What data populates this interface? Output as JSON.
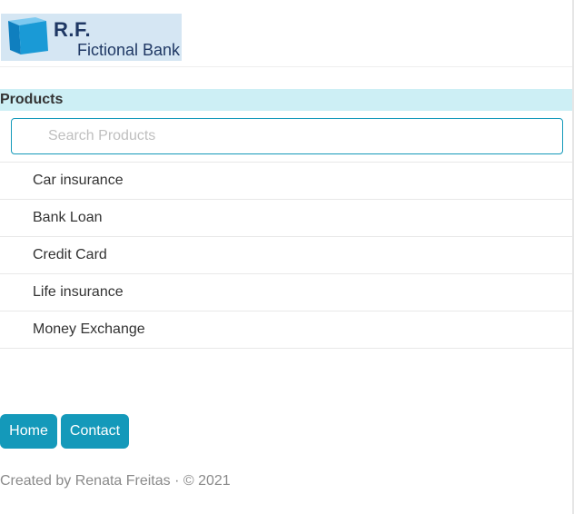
{
  "logo": {
    "initials": "R.F.",
    "name": "Fictional Bank",
    "icon": "blue-cube-icon",
    "colors": {
      "background": "#d5e6f3",
      "cube": "#1a9ad6",
      "text": "#1f3864"
    }
  },
  "products": {
    "title": "Products",
    "search": {
      "placeholder": "Search Products",
      "value": ""
    },
    "items": [
      {
        "label": "Car insurance"
      },
      {
        "label": "Bank Loan"
      },
      {
        "label": "Credit Card"
      },
      {
        "label": "Life insurance"
      },
      {
        "label": "Money Exchange"
      }
    ]
  },
  "nav": {
    "home_label": "Home",
    "contact_label": "Contact"
  },
  "footer": {
    "text": "Created by Renata Freitas · © 2021"
  },
  "colors": {
    "accent": "#1499ba",
    "section_bar": "#cdeff5",
    "footer_text": "#8a8a8a"
  }
}
